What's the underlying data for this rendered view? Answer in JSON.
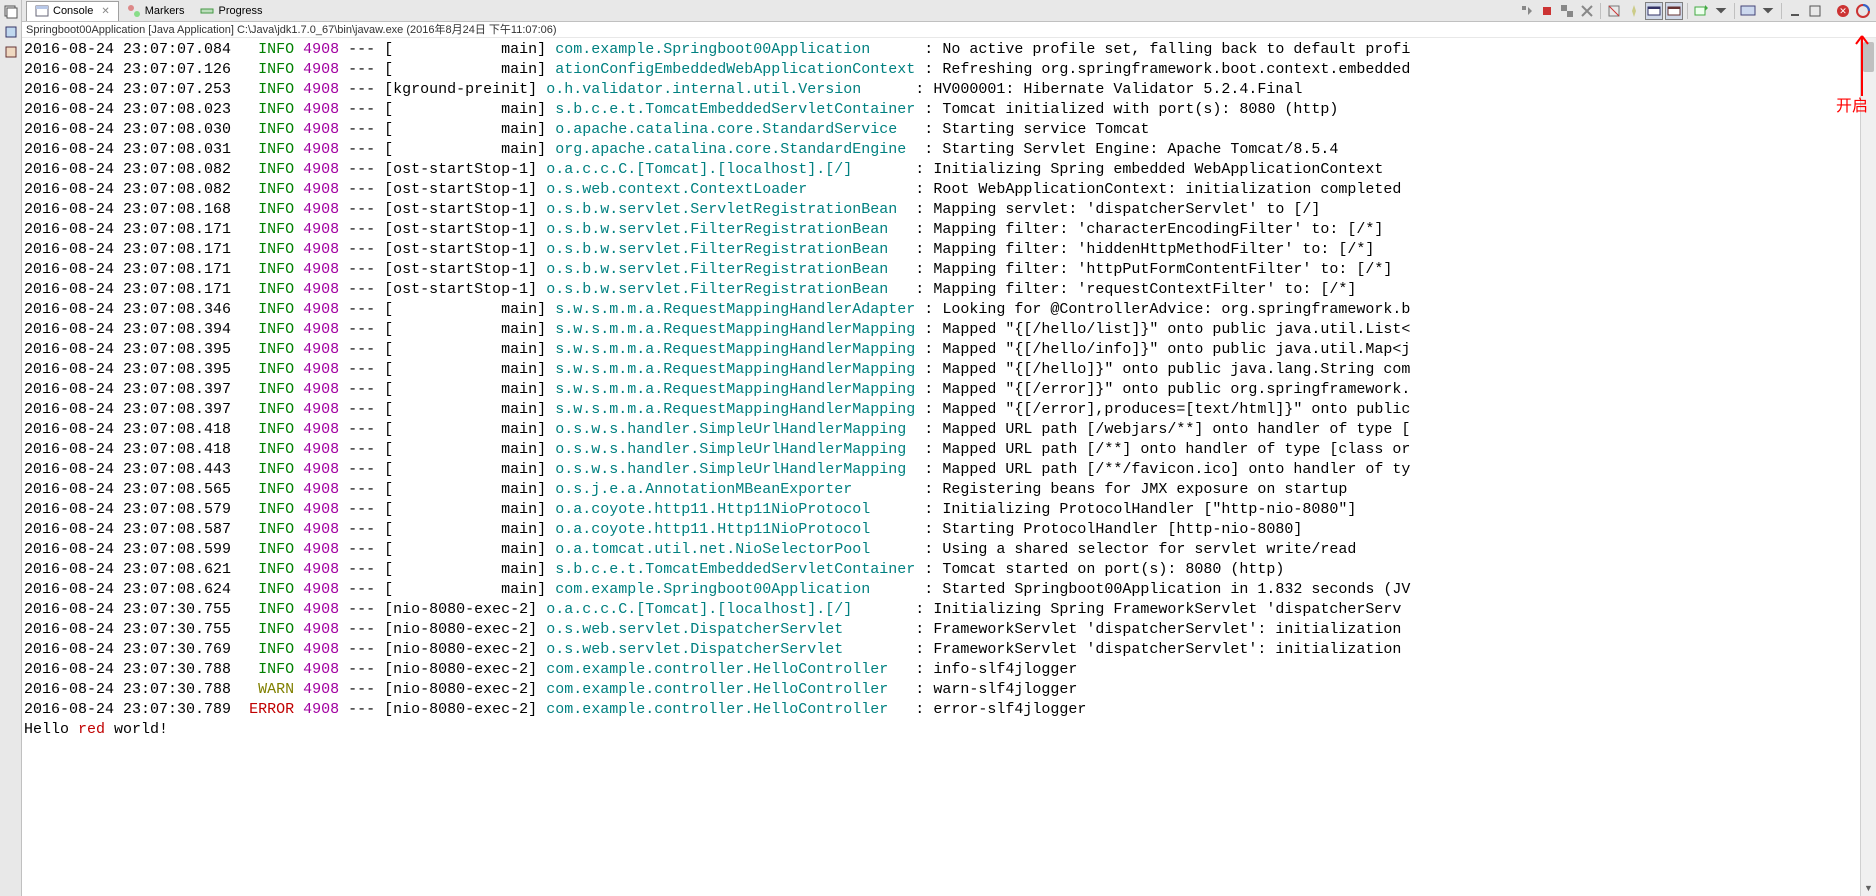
{
  "annotation": {
    "label": "开启"
  },
  "tabs": [
    {
      "label": "Console",
      "active": true
    },
    {
      "label": "Markers",
      "active": false
    },
    {
      "label": "Progress",
      "active": false
    }
  ],
  "toolbar_icons": [
    "close-icon",
    "stop-icon",
    "close-all-icon",
    "clear-icon",
    "separator",
    "pin-icon",
    "display-icon",
    "scroll-lock-icon-a",
    "scroll-lock-icon-b",
    "separator",
    "open-console-icon",
    "separator",
    "dropdown-icon",
    "min-icon",
    "max-icon"
  ],
  "title": "Springboot00Application [Java Application] C:\\Java\\jdk1.7.0_67\\bin\\javaw.exe (2016年8月24日 下午11:07:06)",
  "final_line": {
    "prefix": "Hello ",
    "red": "red",
    "suffix": " world!"
  },
  "rows": [
    {
      "ts": "2016-08-24 23:07:07.084",
      "lev": "INFO",
      "pid": "4908",
      "thread": "[            main]",
      "logger": "com.example.Springboot00Application",
      "msg": "No active profile set, falling back to default profi"
    },
    {
      "ts": "2016-08-24 23:07:07.126",
      "lev": "INFO",
      "pid": "4908",
      "thread": "[            main]",
      "logger": "ationConfigEmbeddedWebApplicationContext",
      "msg": "Refreshing org.springframework.boot.context.embedded"
    },
    {
      "ts": "2016-08-24 23:07:07.253",
      "lev": "INFO",
      "pid": "4908",
      "thread": "[kground-preinit]",
      "logger": "o.h.validator.internal.util.Version",
      "msg": "HV000001: Hibernate Validator 5.2.4.Final"
    },
    {
      "ts": "2016-08-24 23:07:08.023",
      "lev": "INFO",
      "pid": "4908",
      "thread": "[            main]",
      "logger": "s.b.c.e.t.TomcatEmbeddedServletContainer",
      "msg": "Tomcat initialized with port(s): 8080 (http)"
    },
    {
      "ts": "2016-08-24 23:07:08.030",
      "lev": "INFO",
      "pid": "4908",
      "thread": "[            main]",
      "logger": "o.apache.catalina.core.StandardService",
      "msg": "Starting service Tomcat"
    },
    {
      "ts": "2016-08-24 23:07:08.031",
      "lev": "INFO",
      "pid": "4908",
      "thread": "[            main]",
      "logger": "org.apache.catalina.core.StandardEngine",
      "msg": "Starting Servlet Engine: Apache Tomcat/8.5.4"
    },
    {
      "ts": "2016-08-24 23:07:08.082",
      "lev": "INFO",
      "pid": "4908",
      "thread": "[ost-startStop-1]",
      "logger": "o.a.c.c.C.[Tomcat].[localhost].[/]",
      "msg": "Initializing Spring embedded WebApplicationContext"
    },
    {
      "ts": "2016-08-24 23:07:08.082",
      "lev": "INFO",
      "pid": "4908",
      "thread": "[ost-startStop-1]",
      "logger": "o.s.web.context.ContextLoader",
      "msg": "Root WebApplicationContext: initialization completed"
    },
    {
      "ts": "2016-08-24 23:07:08.168",
      "lev": "INFO",
      "pid": "4908",
      "thread": "[ost-startStop-1]",
      "logger": "o.s.b.w.servlet.ServletRegistrationBean",
      "msg": "Mapping servlet: 'dispatcherServlet' to [/]"
    },
    {
      "ts": "2016-08-24 23:07:08.171",
      "lev": "INFO",
      "pid": "4908",
      "thread": "[ost-startStop-1]",
      "logger": "o.s.b.w.servlet.FilterRegistrationBean",
      "msg": "Mapping filter: 'characterEncodingFilter' to: [/*]"
    },
    {
      "ts": "2016-08-24 23:07:08.171",
      "lev": "INFO",
      "pid": "4908",
      "thread": "[ost-startStop-1]",
      "logger": "o.s.b.w.servlet.FilterRegistrationBean",
      "msg": "Mapping filter: 'hiddenHttpMethodFilter' to: [/*]"
    },
    {
      "ts": "2016-08-24 23:07:08.171",
      "lev": "INFO",
      "pid": "4908",
      "thread": "[ost-startStop-1]",
      "logger": "o.s.b.w.servlet.FilterRegistrationBean",
      "msg": "Mapping filter: 'httpPutFormContentFilter' to: [/*]"
    },
    {
      "ts": "2016-08-24 23:07:08.171",
      "lev": "INFO",
      "pid": "4908",
      "thread": "[ost-startStop-1]",
      "logger": "o.s.b.w.servlet.FilterRegistrationBean",
      "msg": "Mapping filter: 'requestContextFilter' to: [/*]"
    },
    {
      "ts": "2016-08-24 23:07:08.346",
      "lev": "INFO",
      "pid": "4908",
      "thread": "[            main]",
      "logger": "s.w.s.m.m.a.RequestMappingHandlerAdapter",
      "msg": "Looking for @ControllerAdvice: org.springframework.b"
    },
    {
      "ts": "2016-08-24 23:07:08.394",
      "lev": "INFO",
      "pid": "4908",
      "thread": "[            main]",
      "logger": "s.w.s.m.m.a.RequestMappingHandlerMapping",
      "msg": "Mapped \"{[/hello/list]}\" onto public java.util.List<"
    },
    {
      "ts": "2016-08-24 23:07:08.395",
      "lev": "INFO",
      "pid": "4908",
      "thread": "[            main]",
      "logger": "s.w.s.m.m.a.RequestMappingHandlerMapping",
      "msg": "Mapped \"{[/hello/info]}\" onto public java.util.Map<j"
    },
    {
      "ts": "2016-08-24 23:07:08.395",
      "lev": "INFO",
      "pid": "4908",
      "thread": "[            main]",
      "logger": "s.w.s.m.m.a.RequestMappingHandlerMapping",
      "msg": "Mapped \"{[/hello]}\" onto public java.lang.String com"
    },
    {
      "ts": "2016-08-24 23:07:08.397",
      "lev": "INFO",
      "pid": "4908",
      "thread": "[            main]",
      "logger": "s.w.s.m.m.a.RequestMappingHandlerMapping",
      "msg": "Mapped \"{[/error]}\" onto public org.springframework."
    },
    {
      "ts": "2016-08-24 23:07:08.397",
      "lev": "INFO",
      "pid": "4908",
      "thread": "[            main]",
      "logger": "s.w.s.m.m.a.RequestMappingHandlerMapping",
      "msg": "Mapped \"{[/error],produces=[text/html]}\" onto public"
    },
    {
      "ts": "2016-08-24 23:07:08.418",
      "lev": "INFO",
      "pid": "4908",
      "thread": "[            main]",
      "logger": "o.s.w.s.handler.SimpleUrlHandlerMapping",
      "msg": "Mapped URL path [/webjars/**] onto handler of type ["
    },
    {
      "ts": "2016-08-24 23:07:08.418",
      "lev": "INFO",
      "pid": "4908",
      "thread": "[            main]",
      "logger": "o.s.w.s.handler.SimpleUrlHandlerMapping",
      "msg": "Mapped URL path [/**] onto handler of type [class or"
    },
    {
      "ts": "2016-08-24 23:07:08.443",
      "lev": "INFO",
      "pid": "4908",
      "thread": "[            main]",
      "logger": "o.s.w.s.handler.SimpleUrlHandlerMapping",
      "msg": "Mapped URL path [/**/favicon.ico] onto handler of ty"
    },
    {
      "ts": "2016-08-24 23:07:08.565",
      "lev": "INFO",
      "pid": "4908",
      "thread": "[            main]",
      "logger": "o.s.j.e.a.AnnotationMBeanExporter",
      "msg": "Registering beans for JMX exposure on startup"
    },
    {
      "ts": "2016-08-24 23:07:08.579",
      "lev": "INFO",
      "pid": "4908",
      "thread": "[            main]",
      "logger": "o.a.coyote.http11.Http11NioProtocol",
      "msg": "Initializing ProtocolHandler [\"http-nio-8080\"]"
    },
    {
      "ts": "2016-08-24 23:07:08.587",
      "lev": "INFO",
      "pid": "4908",
      "thread": "[            main]",
      "logger": "o.a.coyote.http11.Http11NioProtocol",
      "msg": "Starting ProtocolHandler [http-nio-8080]"
    },
    {
      "ts": "2016-08-24 23:07:08.599",
      "lev": "INFO",
      "pid": "4908",
      "thread": "[            main]",
      "logger": "o.a.tomcat.util.net.NioSelectorPool",
      "msg": "Using a shared selector for servlet write/read"
    },
    {
      "ts": "2016-08-24 23:07:08.621",
      "lev": "INFO",
      "pid": "4908",
      "thread": "[            main]",
      "logger": "s.b.c.e.t.TomcatEmbeddedServletContainer",
      "msg": "Tomcat started on port(s): 8080 (http)"
    },
    {
      "ts": "2016-08-24 23:07:08.624",
      "lev": "INFO",
      "pid": "4908",
      "thread": "[            main]",
      "logger": "com.example.Springboot00Application",
      "msg": "Started Springboot00Application in 1.832 seconds (JV"
    },
    {
      "ts": "2016-08-24 23:07:30.755",
      "lev": "INFO",
      "pid": "4908",
      "thread": "[nio-8080-exec-2]",
      "logger": "o.a.c.c.C.[Tomcat].[localhost].[/]",
      "msg": "Initializing Spring FrameworkServlet 'dispatcherServ"
    },
    {
      "ts": "2016-08-24 23:07:30.755",
      "lev": "INFO",
      "pid": "4908",
      "thread": "[nio-8080-exec-2]",
      "logger": "o.s.web.servlet.DispatcherServlet",
      "msg": "FrameworkServlet 'dispatcherServlet': initialization"
    },
    {
      "ts": "2016-08-24 23:07:30.769",
      "lev": "INFO",
      "pid": "4908",
      "thread": "[nio-8080-exec-2]",
      "logger": "o.s.web.servlet.DispatcherServlet",
      "msg": "FrameworkServlet 'dispatcherServlet': initialization"
    },
    {
      "ts": "2016-08-24 23:07:30.788",
      "lev": "INFO",
      "pid": "4908",
      "thread": "[nio-8080-exec-2]",
      "logger": "com.example.controller.HelloController",
      "msg": "info-slf4jlogger"
    },
    {
      "ts": "2016-08-24 23:07:30.788",
      "lev": "WARN",
      "pid": "4908",
      "thread": "[nio-8080-exec-2]",
      "logger": "com.example.controller.HelloController",
      "msg": "warn-slf4jlogger"
    },
    {
      "ts": "2016-08-24 23:07:30.789",
      "lev": "ERROR",
      "pid": "4908",
      "thread": "[nio-8080-exec-2]",
      "logger": "com.example.controller.HelloController",
      "msg": "error-slf4jlogger"
    }
  ]
}
